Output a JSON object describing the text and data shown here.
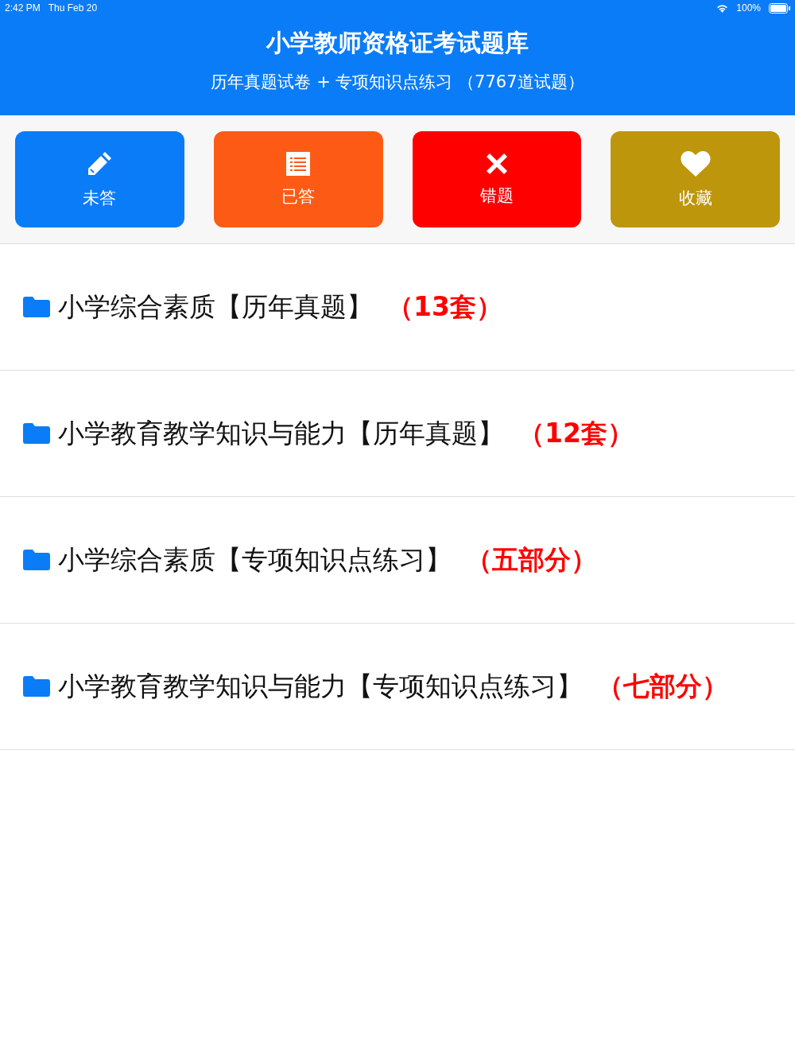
{
  "status_bar": {
    "time": "2:42 PM",
    "date": "Thu Feb 20",
    "battery": "100%"
  },
  "header": {
    "title": "小学教师资格证考试题库",
    "subtitle": "历年真题试卷 + 专项知识点练习 （7767道试题）"
  },
  "actions": [
    {
      "label": "未答",
      "kind": "pencil",
      "color": "#0a7cf7"
    },
    {
      "label": "已答",
      "kind": "list",
      "color": "#fd5b15"
    },
    {
      "label": "错题",
      "kind": "cross",
      "color": "#fe0000"
    },
    {
      "label": "收藏",
      "kind": "heart",
      "color": "#be960b"
    }
  ],
  "folders": [
    {
      "title": "小学综合素质【历年真题】",
      "count": "（13套）"
    },
    {
      "title": "小学教育教学知识与能力【历年真题】",
      "count": "（12套）"
    },
    {
      "title": "小学综合素质【专项知识点练习】",
      "count": "（五部分）"
    },
    {
      "title": "小学教育教学知识与能力【专项知识点练习】",
      "count": "（七部分）"
    }
  ]
}
